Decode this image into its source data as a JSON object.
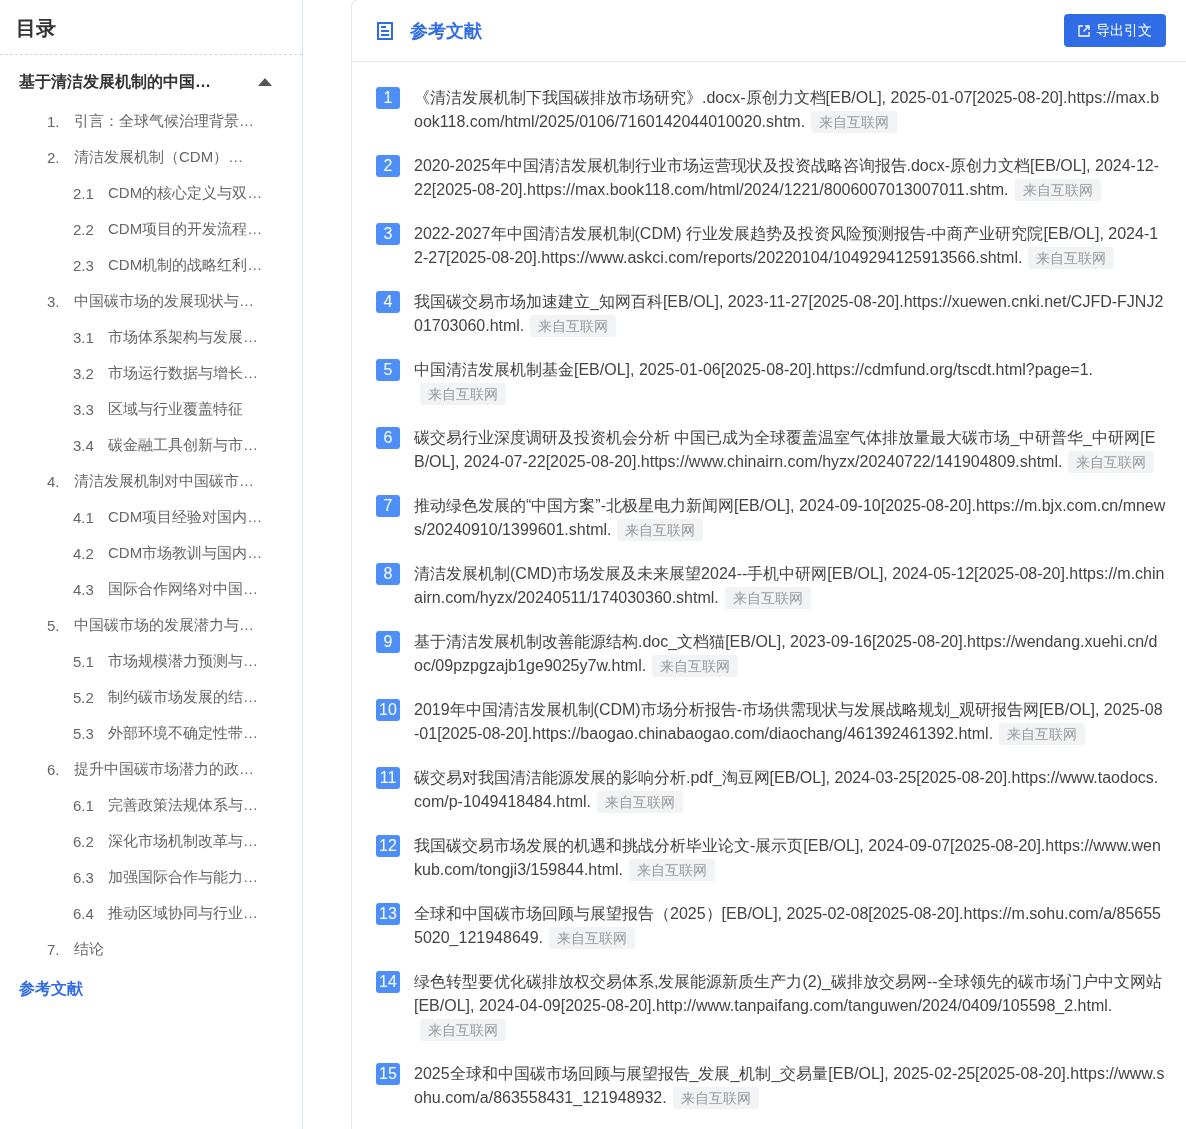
{
  "sidebar": {
    "title": "目录",
    "book": {
      "title": "基于清洁发展机制的中国…",
      "expanded": true,
      "children": [
        {
          "number": "1.",
          "label": "引言：全球气候治理背景…"
        },
        {
          "number": "2.",
          "label": "清洁发展机制（CDM）…",
          "children": [
            {
              "number": "2.1",
              "label": "CDM的核心定义与双…"
            },
            {
              "number": "2.2",
              "label": "CDM项目的开发流程…"
            },
            {
              "number": "2.3",
              "label": "CDM机制的战略红利…"
            }
          ]
        },
        {
          "number": "3.",
          "label": "中国碳市场的发展现状与…",
          "children": [
            {
              "number": "3.1",
              "label": "市场体系架构与发展…"
            },
            {
              "number": "3.2",
              "label": "市场运行数据与增长…"
            },
            {
              "number": "3.3",
              "label": "区域与行业覆盖特征"
            },
            {
              "number": "3.4",
              "label": "碳金融工具创新与市…"
            }
          ]
        },
        {
          "number": "4.",
          "label": "清洁发展机制对中国碳市…",
          "children": [
            {
              "number": "4.1",
              "label": "CDM项目经验对国内…"
            },
            {
              "number": "4.2",
              "label": "CDM市场教训与国内…"
            },
            {
              "number": "4.3",
              "label": "国际合作网络对中国…"
            }
          ]
        },
        {
          "number": "5.",
          "label": "中国碳市场的发展潜力与…",
          "children": [
            {
              "number": "5.1",
              "label": "市场规模潜力预测与…"
            },
            {
              "number": "5.2",
              "label": "制约碳市场发展的结…"
            },
            {
              "number": "5.3",
              "label": "外部环境不确定性带…"
            }
          ]
        },
        {
          "number": "6.",
          "label": "提升中国碳市场潜力的政…",
          "children": [
            {
              "number": "6.1",
              "label": "完善政策法规体系与…"
            },
            {
              "number": "6.2",
              "label": "深化市场机制改革与…"
            },
            {
              "number": "6.3",
              "label": "加强国际合作与能力…"
            },
            {
              "number": "6.4",
              "label": "推动区域协同与行业…"
            }
          ]
        },
        {
          "number": "7.",
          "label": "结论"
        }
      ]
    },
    "link": "参考文献"
  },
  "main": {
    "title": "参考文献",
    "export_button": "导出引文",
    "references": [
      {
        "number": "1",
        "text": "《清洁发展机制下我国碳排放市场研究》.docx-原创力文档[EB/OL], 2025-01-07[2025-08-20].https://max.book118.com/html/2025/0106/7160142044010020.shtm.",
        "source": "来自互联网"
      },
      {
        "number": "2",
        "text": "2020-2025年中国清洁发展机制行业市场运营现状及投资战略咨询报告.docx-原创力文档[EB/OL], 2024-12-22[2025-08-20].https://max.book118.com/html/2024/1221/8006007013007011.shtm.",
        "source": "来自互联网"
      },
      {
        "number": "3",
        "text": "2022-2027年中国清洁发展机制(CDM) 行业发展趋势及投资风险预测报告-中商产业研究院[EB/OL], 2024-12-27[2025-08-20].https://www.askci.com/reports/20220104/1049294125913566.shtml.",
        "source": "来自互联网"
      },
      {
        "number": "4",
        "text": "我国碳交易市场加速建立_知网百科[EB/OL], 2023-11-27[2025-08-20].https://xuewen.cnki.net/CJFD-FJNJ201703060.html.",
        "source": "来自互联网"
      },
      {
        "number": "5",
        "text": "中国清洁发展机制基金[EB/OL], 2025-01-06[2025-08-20].https://cdmfund.org/tscdt.html?page=1.",
        "source": "来自互联网"
      },
      {
        "number": "6",
        "text": "碳交易行业深度调研及投资机会分析 中国已成为全球覆盖温室气体排放量最大碳市场_中研普华_中研网[EB/OL], 2024-07-22[2025-08-20].https://www.chinairn.com/hyzx/20240722/141904809.shtml.",
        "source": "来自互联网"
      },
      {
        "number": "7",
        "text": "推动绿色发展的“中国方案”-北极星电力新闻网[EB/OL], 2024-09-10[2025-08-20].https://m.bjx.com.cn/mnews/20240910/1399601.shtml.",
        "source": "来自互联网"
      },
      {
        "number": "8",
        "text": "清洁发展机制(CMD)市场发展及未来展望2024--手机中研网[EB/OL], 2024-05-12[2025-08-20].https://m.chinairn.com/hyzx/20240511/174030360.shtml.",
        "source": "来自互联网"
      },
      {
        "number": "9",
        "text": "基于清洁发展机制改善能源结构.doc_文档猫[EB/OL], 2023-09-16[2025-08-20].https://wendang.xuehi.cn/doc/09pzpgzajb1ge9025y7w.html.",
        "source": "来自互联网"
      },
      {
        "number": "10",
        "text": "2019年中国清洁发展机制(CDM)市场分析报告-市场供需现状与发展战略规划_观研报告网[EB/OL], 2025-08-01[2025-08-20].https://baogao.chinabaogao.com/diaochang/461392461392.html.",
        "source": "来自互联网"
      },
      {
        "number": "11",
        "text": "碳交易对我国清洁能源发展的影响分析.pdf_淘豆网[EB/OL], 2024-03-25[2025-08-20].https://www.taodocs.com/p-1049418484.html.",
        "source": "来自互联网"
      },
      {
        "number": "12",
        "text": "我国碳交易市场发展的机遇和挑战分析毕业论文-展示页[EB/OL], 2024-09-07[2025-08-20].https://www.wenkub.com/tongji3/159844.html.",
        "source": "来自互联网"
      },
      {
        "number": "13",
        "text": "全球和中国碳市场回顾与展望报告（2025）[EB/OL], 2025-02-08[2025-08-20].https://m.sohu.com/a/856555020_121948649.",
        "source": "来自互联网"
      },
      {
        "number": "14",
        "text": "绿色转型要优化碳排放权交易体系,发展能源新质生产力(2)_碳排放交易网--全球领先的碳市场门户中文网站[EB/OL], 2024-04-09[2025-08-20].http://www.tanpaifang.com/tanguwen/2024/0409/105598_2.html.",
        "source": "来自互联网"
      },
      {
        "number": "15",
        "text": "2025全球和中国碳市场回顾与展望报告_发展_机制_交易量[EB/OL], 2025-02-25[2025-08-20].https://www.sohu.com/a/863558431_121948932.",
        "source": "来自互联网"
      }
    ]
  }
}
